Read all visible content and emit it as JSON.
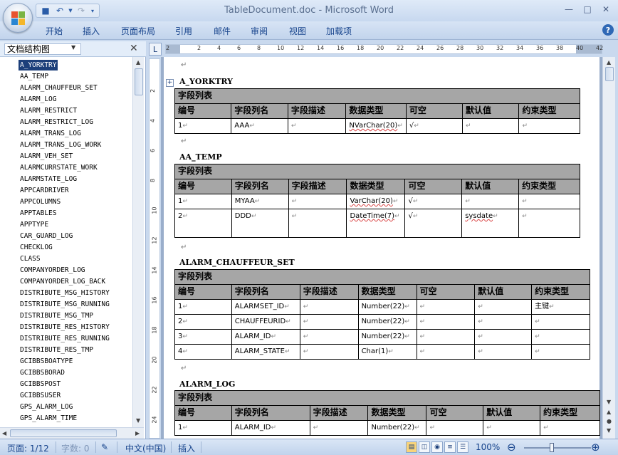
{
  "window": {
    "title": "TableDocument.doc - Microsoft Word"
  },
  "ribbon": {
    "tabs": [
      "开始",
      "插入",
      "页面布局",
      "引用",
      "邮件",
      "审阅",
      "视图",
      "加载项"
    ]
  },
  "docmap": {
    "title": "文档结构图",
    "items": [
      "A_YORKTRY",
      "AA_TEMP",
      "ALARM_CHAUFFEUR_SET",
      "ALARM_LOG",
      "ALARM_RESTRICT",
      "ALARM_RESTRICT_LOG",
      "ALARM_TRANS_LOG",
      "ALARM_TRANS_LOG_WORK",
      "ALARM_VEH_SET",
      "ALARMCURRSTATE_WORK",
      "ALARMSTATE_LOG",
      "APPCARDRIVER",
      "APPCOLUMNS",
      "APPTABLES",
      "APPTYPE",
      "CAR_GUARD_LOG",
      "CHECKLOG",
      "CLASS",
      "COMPANYORDER_LOG",
      "COMPANYORDER_LOG_BACK",
      "DISTRIBUTE_MSG_HISTORY",
      "DISTRIBUTE_MSG_RUNNING",
      "DISTRIBUTE_MSG_TMP",
      "DISTRIBUTE_RES_HISTORY",
      "DISTRIBUTE_RES_RUNNING",
      "DISTRIBUTE_RES_TMP",
      "GCIBBSBOATYPE",
      "GCIBBSBORAD",
      "GCIBBSPOST",
      "GCIBBSUSER",
      "GPS_ALARM_LOG",
      "GPS_ALARM_TIME"
    ]
  },
  "ruler": {
    "h": [
      "2",
      "2",
      "4",
      "6",
      "8",
      "10",
      "12",
      "14",
      "16",
      "18",
      "20",
      "22",
      "24",
      "26",
      "28",
      "30",
      "32",
      "34",
      "36",
      "38",
      "40",
      "42"
    ],
    "v": [
      "2",
      "4",
      "6",
      "8",
      "10",
      "12",
      "14",
      "16",
      "18",
      "20",
      "22",
      "24"
    ]
  },
  "doc": {
    "caption": "字段列表",
    "headers": [
      "编号",
      "字段列名",
      "字段描述",
      "数据类型",
      "可空",
      "默认值",
      "约束类型"
    ],
    "t1": {
      "name": "A_YORKTRY",
      "rows": [
        [
          "1",
          "AAA",
          "",
          "NVarChar(20)",
          "√",
          "",
          ""
        ]
      ]
    },
    "t2": {
      "name": "AA_TEMP",
      "rows": [
        [
          "1",
          "MYAA",
          "",
          "VarChar(20)",
          "√",
          "",
          ""
        ],
        [
          "2",
          "DDD",
          "",
          "DateTime(7)",
          "√",
          "sysdate",
          ""
        ]
      ]
    },
    "t3": {
      "name": "ALARM_CHAUFFEUR_SET",
      "rows": [
        [
          "1",
          "ALARMSET_ID",
          "",
          "Number(22)",
          "",
          "",
          "主键"
        ],
        [
          "2",
          "CHAUFFEURID",
          "",
          "Number(22)",
          "",
          "",
          ""
        ],
        [
          "3",
          "ALARM_ID",
          "",
          "Number(22)",
          "",
          "",
          ""
        ],
        [
          "4",
          "ALARM_STATE",
          "",
          "Char(1)",
          "",
          "",
          ""
        ]
      ]
    },
    "t4": {
      "name": "ALARM_LOG",
      "rows": [
        [
          "1",
          "ALARM_ID",
          "",
          "Number(22)",
          "",
          "",
          ""
        ]
      ]
    }
  },
  "status": {
    "page": "页面: 1/12",
    "words": "字数: 0",
    "lang": "中文(中国)",
    "mode": "插入",
    "zoom": "100%"
  }
}
